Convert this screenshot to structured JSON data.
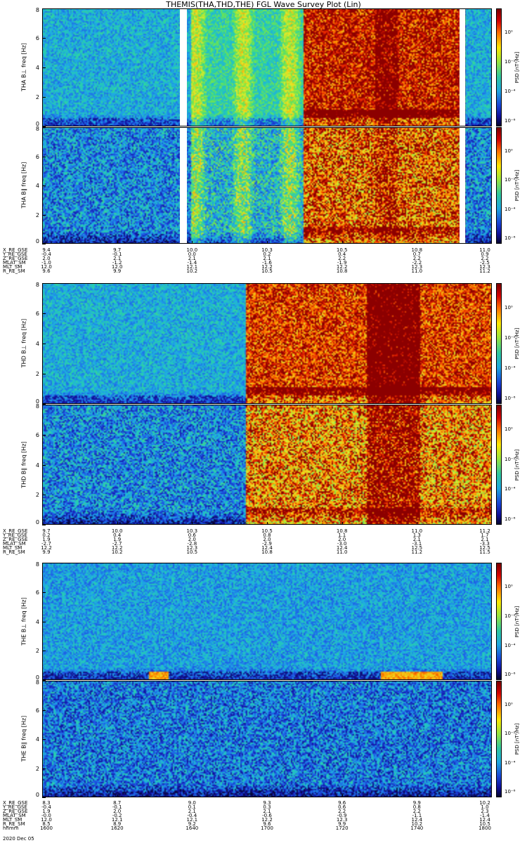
{
  "page": {
    "title": "THEMIS(THA,THD,THE) FGL Wave Survey Plot (Lin)",
    "date": "2020 Dec 05"
  },
  "colorbar": {
    "label": "PSD [nT²/Hz]",
    "ticks": [
      "10⁰",
      "10⁻²",
      "10⁻⁴",
      "10⁻⁶"
    ]
  },
  "y_ticks": [
    "0",
    "2",
    "4",
    "6",
    "8"
  ],
  "chart_data": [
    {
      "type": "heatmap",
      "probe": "THA",
      "name": "THA B⊥",
      "ylabel": "THA B⊥ freq [Hz]",
      "ylim": [
        0,
        8
      ],
      "data_gaps": [
        "10.0 (start)",
        "11.0 (end)"
      ],
      "features": [
        "broadband emission from ~10.4 to ~10.9",
        "low-frequency enhancement near 10.4"
      ]
    },
    {
      "type": "heatmap",
      "probe": "THA",
      "name": "THA B∥",
      "ylabel": "THA B∥ freq [Hz]",
      "ylim": [
        0,
        8
      ]
    },
    {
      "type": "heatmap",
      "probe": "THD",
      "name": "THD B⊥",
      "ylabel": "THD B⊥ freq [Hz]",
      "ylim": [
        0,
        8
      ],
      "features": [
        "broadband emission after ~10.4",
        "strong activity near 10.9"
      ]
    },
    {
      "type": "heatmap",
      "probe": "THD",
      "name": "THD B∥",
      "ylabel": "THD B∥ freq [Hz]",
      "ylim": [
        0,
        8
      ]
    },
    {
      "type": "heatmap",
      "probe": "THE",
      "name": "THE B⊥",
      "ylabel": "THE B⊥ freq [Hz]",
      "ylim": [
        0,
        8
      ],
      "features": [
        "narrow low-frequency bursts around 1620 and 1720"
      ]
    },
    {
      "type": "heatmap",
      "probe": "THE",
      "name": "THE B∥",
      "ylabel": "THE B∥ freq [Hz]",
      "ylim": [
        0,
        8
      ]
    }
  ],
  "orbit_blocks": [
    {
      "labels": [
        "X_RE_GSE",
        "Y_RE_GSE",
        "Z_RE_GSE",
        "MLAT_SM",
        "MLT_SM",
        "R_RE_SM"
      ],
      "rows": [
        [
          "9.4",
          "9.7",
          "10.0",
          "10.3",
          "10.5",
          "10.8",
          "11.0"
        ],
        [
          "-0.4",
          "-0.1",
          "0.0",
          "0.2",
          "0.4",
          "0.7",
          "0.9"
        ],
        [
          "2.0",
          "2.1",
          "2.1",
          "2.1",
          "2.2",
          "2.2",
          "2.2"
        ],
        [
          "-1.0",
          "-1.2",
          "-1.4",
          "-1.6",
          "-1.9",
          "-2.2",
          "-2.5"
        ],
        [
          "12.0",
          "12.0",
          "12.1",
          "12.2",
          "12.2",
          "12.3",
          "12.3"
        ],
        [
          "9.6",
          "9.9",
          "10.2",
          "10.5",
          "10.8",
          "11.0",
          "11.2"
        ]
      ]
    },
    {
      "labels": [
        "X_RE_GSE",
        "Y_RE_GSE",
        "Z_RE_GSE",
        "MLAT_SM",
        "MLT_SM",
        "R_RE_SM"
      ],
      "rows": [
        [
          "9.7",
          "10.0",
          "10.3",
          "10.5",
          "10.8",
          "11.0",
          "11.2"
        ],
        [
          "0.2",
          "0.4",
          "0.6",
          "0.8",
          "1.1",
          "1.3",
          "1.7"
        ],
        [
          "1.9",
          "1.9",
          "2.0",
          "2.0",
          "2.0",
          "2.1",
          "2.1"
        ],
        [
          "-2.7",
          "-2.7",
          "-2.8",
          "-2.9",
          "-3.0",
          "-3.1",
          "-3.3"
        ],
        [
          "12.2",
          "12.2",
          "12.3",
          "12.4",
          "12.4",
          "12.5",
          "12.5"
        ],
        [
          "9.9",
          "10.2",
          "10.5",
          "10.8",
          "11.0",
          "11.2",
          "11.5"
        ]
      ]
    },
    {
      "labels": [
        "X_RE_GSE",
        "Y_RE_GSE",
        "Z_RE_GSE",
        "MLAT_SM",
        "MLT_SM",
        "R_RE_SM",
        "hhmm"
      ],
      "rows": [
        [
          "8.3",
          "8.7",
          "9.0",
          "9.3",
          "9.6",
          "9.9",
          "10.2"
        ],
        [
          "-0.4",
          "-0.1",
          "0.1",
          "0.3",
          "0.6",
          "0.8",
          "1.0"
        ],
        [
          "1.9",
          "2.0",
          "2.1",
          "2.1",
          "2.2",
          "2.2",
          "2.3"
        ],
        [
          "-0.0",
          "-0.2",
          "-0.4",
          "-0.6",
          "-0.9",
          "-1.1",
          "-1.4"
        ],
        [
          "12.0",
          "12.1",
          "12.1",
          "12.2",
          "12.3",
          "12.4",
          "12.4"
        ],
        [
          "8.5",
          "8.9",
          "9.2",
          "9.6",
          "9.9",
          "10.2",
          "10.5"
        ],
        [
          "1600",
          "1620",
          "1640",
          "1700",
          "1720",
          "1740",
          "1800"
        ]
      ]
    }
  ]
}
